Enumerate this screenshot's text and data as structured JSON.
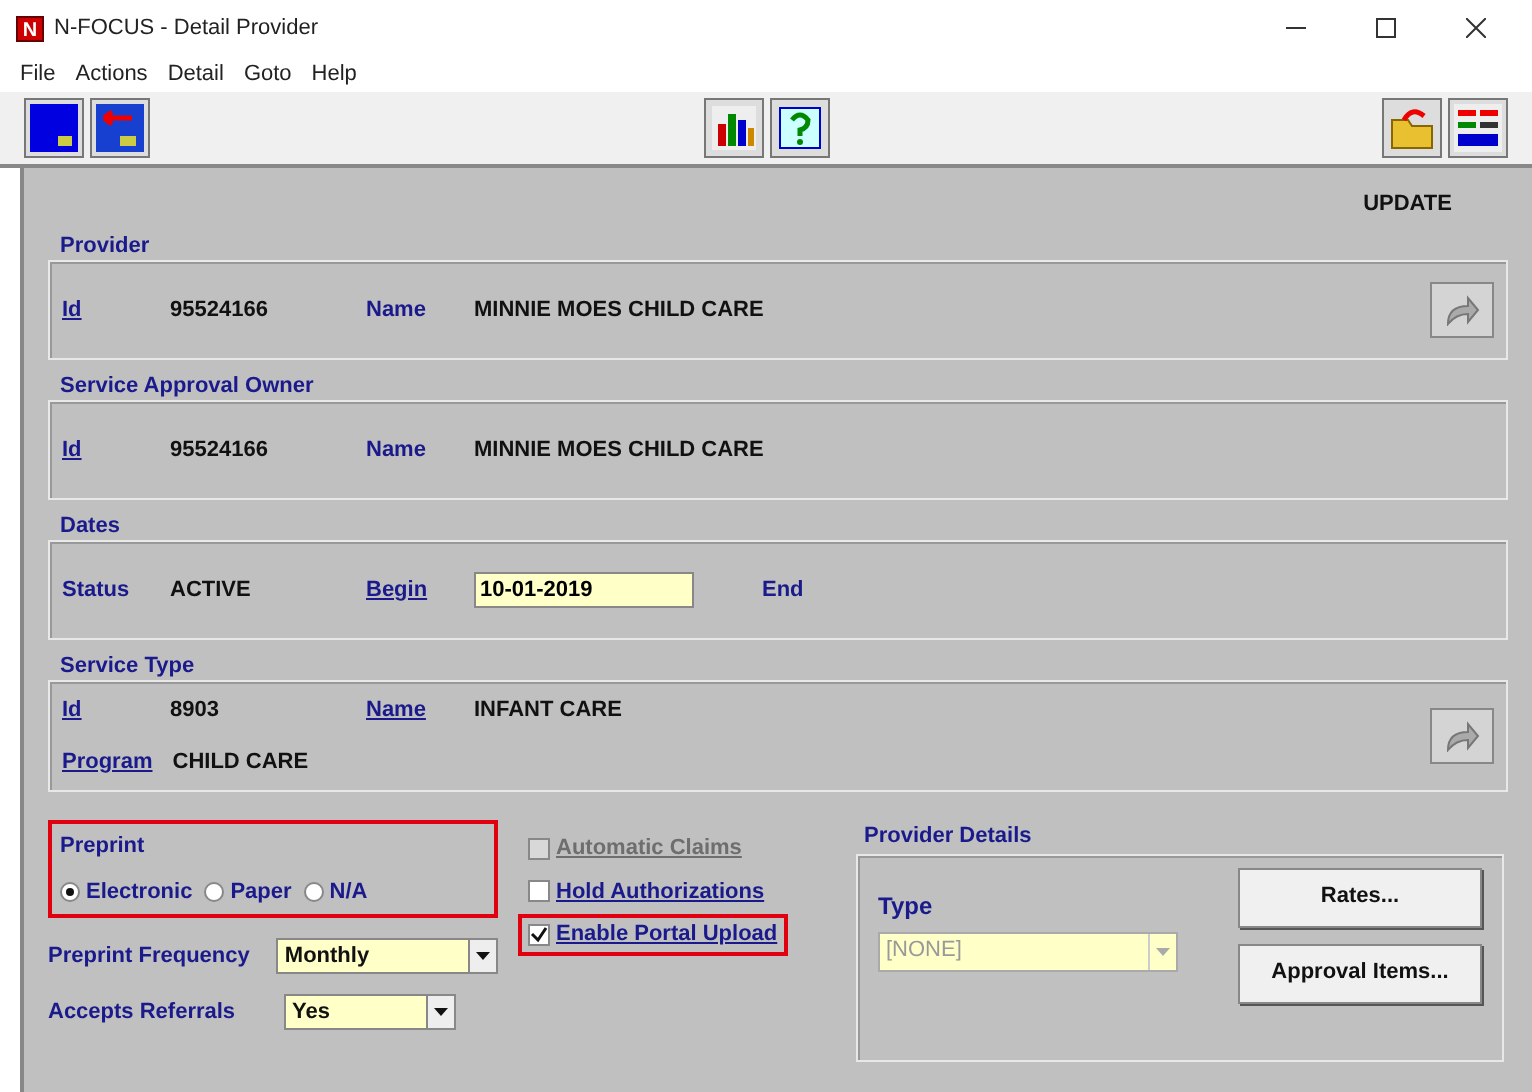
{
  "window": {
    "title": "N-FOCUS - Detail Provider",
    "logo": "N"
  },
  "menu": [
    "File",
    "Actions",
    "Detail",
    "Goto",
    "Help"
  ],
  "mode": "UPDATE",
  "sections": [
    {
      "title": "Provider",
      "navigate": true,
      "rows": [
        [
          {
            "label": "Id",
            "link": true
          },
          {
            "kind": "text",
            "value": "95524166"
          },
          {
            "label": "Name",
            "link": false
          },
          {
            "kind": "text",
            "value": "MINNIE MOES CHILD CARE"
          }
        ]
      ]
    },
    {
      "title": "Service Approval Owner",
      "navigate": false,
      "rows": [
        [
          {
            "label": "Id",
            "link": true
          },
          {
            "kind": "text",
            "value": "95524166"
          },
          {
            "label": "Name",
            "link": false
          },
          {
            "kind": "text",
            "value": "MINNIE MOES CHILD CARE"
          }
        ]
      ]
    },
    {
      "title": "Dates",
      "navigate": false,
      "rows": [
        [
          {
            "label": "Status",
            "link": false
          },
          {
            "kind": "text",
            "value": "ACTIVE"
          },
          {
            "label": "Begin",
            "link": true
          },
          {
            "kind": "input",
            "value": "10-01-2019"
          },
          {
            "label": "End",
            "link": false
          }
        ]
      ]
    },
    {
      "title": "Service Type",
      "navigate": true,
      "rows": [
        [
          {
            "label": "Id",
            "link": true
          },
          {
            "kind": "text",
            "value": "8903"
          },
          {
            "label": "Name",
            "link": true
          },
          {
            "kind": "text",
            "value": "INFANT CARE"
          }
        ],
        [
          {
            "label": "Program",
            "link": true
          },
          {
            "kind": "text",
            "value": "CHILD CARE"
          }
        ]
      ]
    }
  ],
  "preprint": {
    "title": "Preprint",
    "highlighted": true,
    "options": [
      {
        "label": "Electronic",
        "selected": true
      },
      {
        "label": "Paper",
        "selected": false
      },
      {
        "label": "N/A",
        "selected": false
      }
    ]
  },
  "checkboxes": [
    {
      "label": "Automatic Claims",
      "checked": false,
      "disabled": true,
      "highlighted": false
    },
    {
      "label": "Hold Authorizations",
      "checked": false,
      "disabled": false,
      "highlighted": false
    },
    {
      "label": "Enable Portal Upload",
      "checked": true,
      "disabled": false,
      "highlighted": true
    }
  ],
  "dropdowns": [
    {
      "label": "Preprint Frequency",
      "value": "Monthly"
    },
    {
      "label": "Accepts Referrals",
      "value": "Yes"
    }
  ],
  "provider_details": {
    "title": "Provider Details",
    "type_label": "Type",
    "type_value": "[NONE]",
    "disabled": true
  },
  "buttons": [
    "Rates...",
    "Approval Items..."
  ]
}
